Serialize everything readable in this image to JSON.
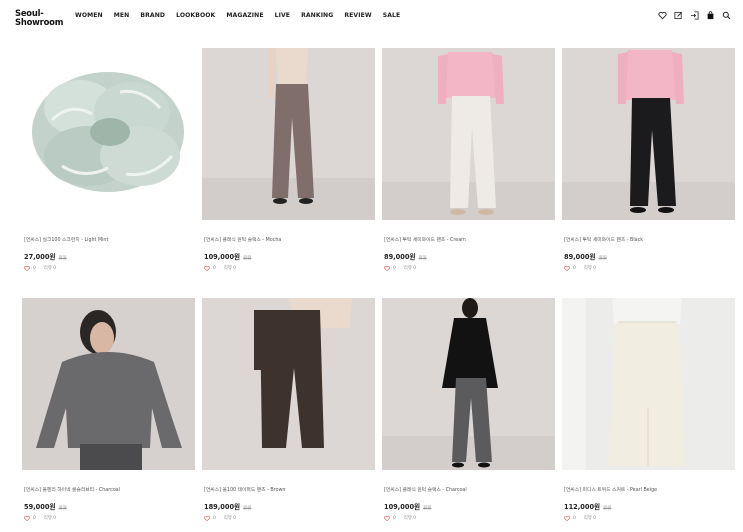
{
  "brand": {
    "line1": "Seoul-",
    "line2": "Showroom"
  },
  "nav": [
    "WOMEN",
    "MEN",
    "BRAND",
    "LOOKBOOK",
    "MAGAZINE",
    "LIVE",
    "RANKING",
    "REVIEW",
    "SALE"
  ],
  "header_icons": [
    "heart-icon",
    "edit-icon",
    "login-icon",
    "bag-icon",
    "search-icon"
  ],
  "products": [
    {
      "name": "[언씨스] 실크100 스크런치 - Light Mint",
      "price": "27,000원",
      "orig": "원원",
      "likes": "0",
      "reviews": "리뷰 0"
    },
    {
      "name": "[언씨스] 클래식 원턱 슬랙스 - Mocha",
      "price": "109,000원",
      "orig": "원원",
      "likes": "0",
      "reviews": "리뷰 0"
    },
    {
      "name": "[언씨스] 투턱 세미와이드 팬츠 - Cream",
      "price": "89,000원",
      "orig": "원원",
      "likes": "0",
      "reviews": "리뷰 0"
    },
    {
      "name": "[언씨스] 투턱 세미와이드 팬츠 - Black",
      "price": "89,000원",
      "orig": "원원",
      "likes": "0",
      "reviews": "리뷰 0"
    },
    {
      "name": "[언씨스] 울헨리 하이넥 롱슬리브티 - Charcoal",
      "price": "59,000원",
      "orig": "원원",
      "likes": "0",
      "reviews": "리뷰 0"
    },
    {
      "name": "[언씨스] 울100 테이퍼드 팬츠 - Brown",
      "price": "189,000원",
      "orig": "원원",
      "likes": "0",
      "reviews": "리뷰 0"
    },
    {
      "name": "[언씨스] 클래식 원턱 슬랙스 - Charcoal",
      "price": "109,000원",
      "orig": "원원",
      "likes": "0",
      "reviews": "리뷰 0"
    },
    {
      "name": "[언씨스] 미디스 트위드 스커트 - Pearl Beige",
      "price": "112,000원",
      "orig": "원원",
      "likes": "0",
      "reviews": "리뷰 0"
    }
  ]
}
